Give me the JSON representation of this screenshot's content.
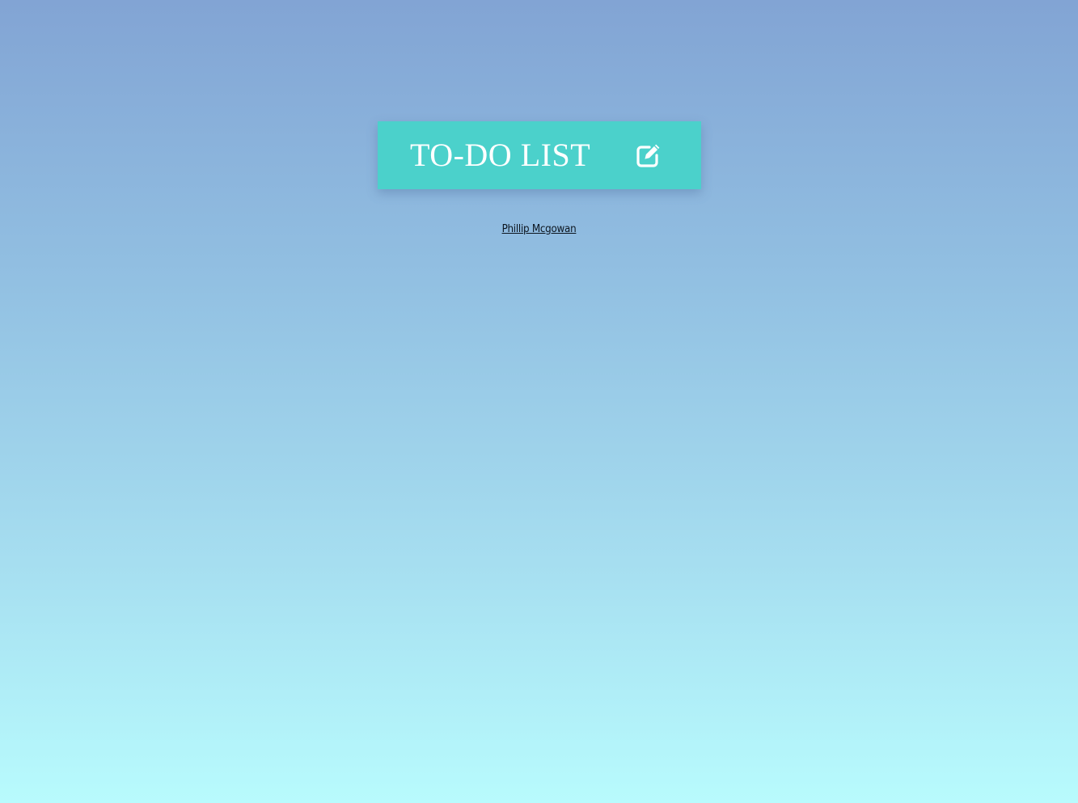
{
  "header": {
    "title": "TO-DO LIST",
    "edit_icon": "pencil-square-edit-icon"
  },
  "footer": {
    "author": "Phillip Mcgowan"
  },
  "colors": {
    "card_background": "#4bd1cb",
    "card_text": "#ffffff",
    "background_top": "#82a4d4",
    "background_bottom": "#b8fbfd",
    "link_text": "#0d1620"
  }
}
